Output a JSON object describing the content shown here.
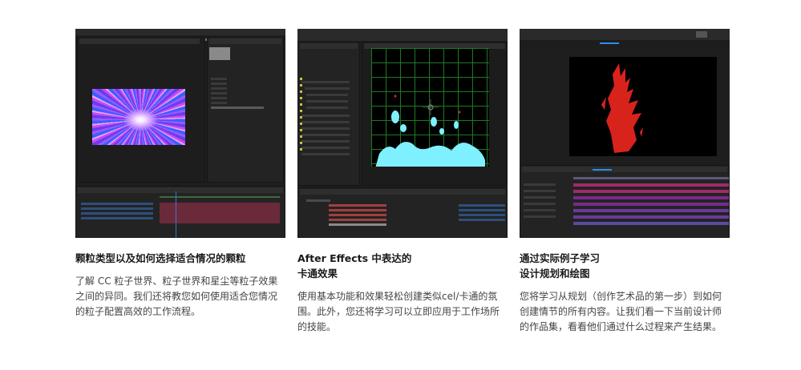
{
  "cards": [
    {
      "title": "颗粒类型以及如何选择适合情况的颗粒",
      "description": "了解 CC 粒子世界、粒子世界和星尘等粒子效果之间的异同。我们还将教您如何使用适合您情况的粒子配置高效的工作流程。",
      "thumbnail_icon": "particle-burst-screenshot"
    },
    {
      "title_line1": "After Effects 中表达的",
      "title_line2": "卡通效果",
      "description": "使用基本功能和效果轻松创建类似cel/卡通的氛围。此外，您还将学习可以立即应用于工作场所的技能。",
      "thumbnail_icon": "cartoon-effect-screenshot"
    },
    {
      "title_line1": "通过实际例子学习",
      "title_line2": "设计规划和绘图",
      "description": "您将学习从规划（创作艺术品的第一步）到如何创建情节的所有内容。让我们看一下当前设计师的作品集，看看他们通过什么过程来产生结果。",
      "thumbnail_icon": "flame-drawing-screenshot"
    }
  ],
  "colors": {
    "ae_dark": "#1e1e1e",
    "ae_panel": "#232323",
    "ae_blue": "#2d8ceb",
    "grid_green": "#1c7a24",
    "cartoon_cyan": "#7ff0ff",
    "flame_red": "#d8231c",
    "timeline_magenta": "#a02a6a"
  }
}
